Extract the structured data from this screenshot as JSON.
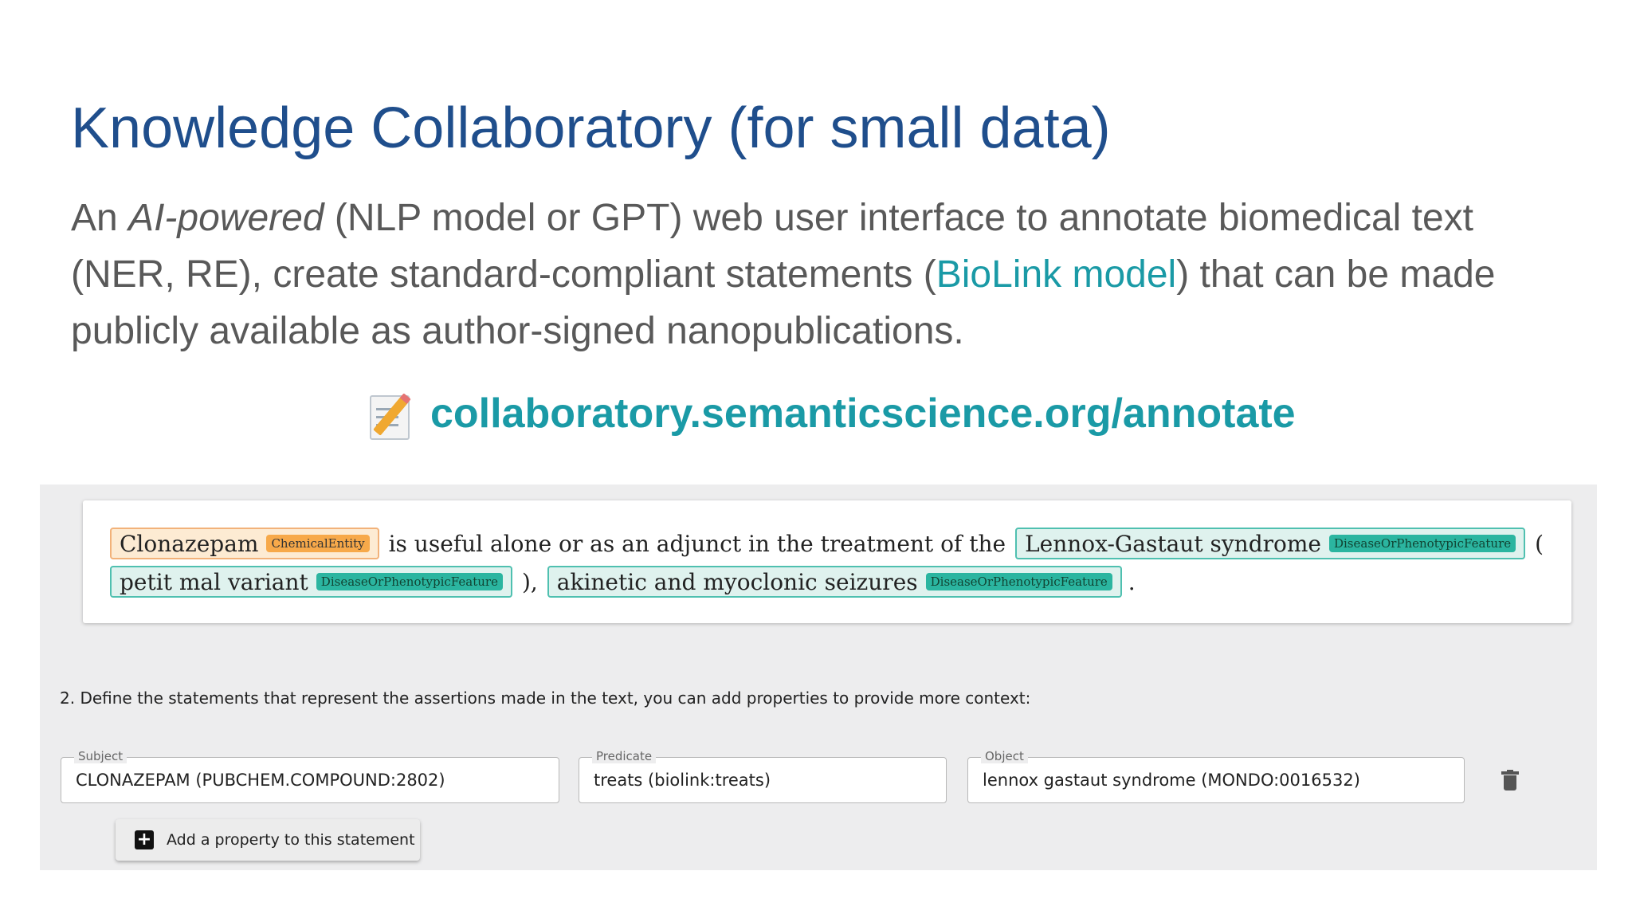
{
  "slide": {
    "title": "Knowledge Collaboratory (for small data)",
    "body": {
      "part1": "An ",
      "emphasis": "AI-powered",
      "part2": " (NLP model or GPT) web user interface to annotate biomedical text (NER, RE), create standard-compliant statements (",
      "link": "BioLink model",
      "part3": ") that can be made publicly available as author-signed nanopublications."
    },
    "url": "collaboratory.semanticscience.org/annotate",
    "url_icon": "memo-icon"
  },
  "annotation": {
    "entities": [
      {
        "text": "Clonazepam",
        "type": "ChemicalEntity"
      },
      {
        "text": "Lennox-Gastaut syndrome",
        "type": "DiseaseOrPhenotypicFeature"
      },
      {
        "text": "petit mal variant",
        "type": "DiseaseOrPhenotypicFeature"
      },
      {
        "text": "akinetic and myoclonic seizures",
        "type": "DiseaseOrPhenotypicFeature"
      }
    ],
    "text_segments": [
      "is useful alone or as an adjunct in the treatment of the",
      "(",
      "),",
      "."
    ]
  },
  "statements": {
    "instruction": "2. Define the statements that represent the assertions made in the text, you can add properties to provide more context:",
    "subject": {
      "label": "Subject",
      "value": "CLONAZEPAM (PUBCHEM.COMPOUND:2802)"
    },
    "predicate": {
      "label": "Predicate",
      "value": "treats (biolink:treats)"
    },
    "object": {
      "label": "Object",
      "value": "lennox gastaut syndrome (MONDO:0016532)"
    },
    "add_property_label": "Add a property to this statement",
    "delete_icon": "trash-icon"
  },
  "colors": {
    "title": "#1f4e8c",
    "link": "#1a9aa6",
    "chemical_entity": "#f7a94a",
    "disease_entity": "#2bb5a0"
  }
}
